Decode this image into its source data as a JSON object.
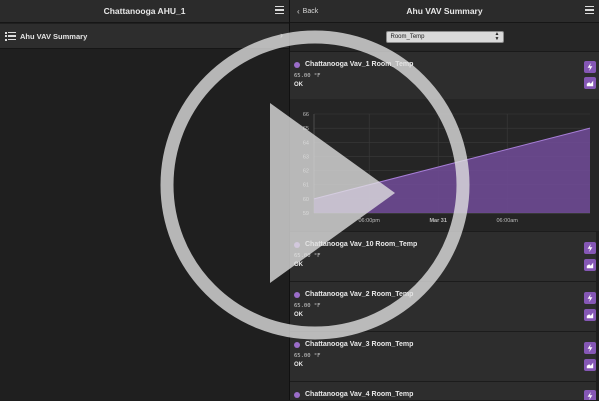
{
  "left_pane": {
    "title": "Chattanooga AHU_1",
    "summary_label": "Ahu VAV Summary"
  },
  "right_pane": {
    "back_label": "Back",
    "title": "Ahu VAV Summary",
    "select_value": "Room_Temp"
  },
  "points": [
    {
      "name": "Chattanooga Vav_1 Room_Temp",
      "value": "65.00 °F",
      "status": "OK"
    },
    {
      "name": "Chattanooga Vav_10 Room_Temp",
      "value": "65.00 °F",
      "status": "OK"
    },
    {
      "name": "Chattanooga Vav_2 Room_Temp",
      "value": "65.00 °F",
      "status": "OK"
    },
    {
      "name": "Chattanooga Vav_3 Room_Temp",
      "value": "65.00 °F",
      "status": "OK"
    },
    {
      "name": "Chattanooga Vav_4 Room_Temp",
      "value": "",
      "status": ""
    }
  ],
  "chart_data": {
    "type": "area",
    "y_ticks": [
      "59",
      "60",
      "61",
      "62",
      "63",
      "64",
      "65",
      "66"
    ],
    "x_ticks": [
      "06:00pm",
      "Mar 31",
      "06:00am"
    ],
    "ylim": [
      59,
      66
    ],
    "series": [
      {
        "values": [
          60,
          65
        ]
      }
    ],
    "grid": true,
    "fill_color": "#6e4a93"
  },
  "colors": {
    "accent": "#8557b5",
    "dot": "#9b6dc9"
  },
  "overlay": {
    "icon": "play-icon"
  }
}
